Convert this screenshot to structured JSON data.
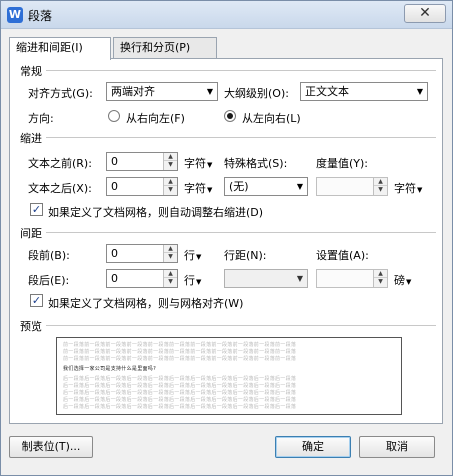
{
  "window": {
    "title": "段落",
    "close_glyph": "✕"
  },
  "tabs": [
    {
      "label": "缩进和间距(I)",
      "active": true
    },
    {
      "label": "换行和分页(P)",
      "active": false
    }
  ],
  "general": {
    "title": "常规",
    "align_label": "对齐方式(G):",
    "align_value": "两端对齐",
    "outline_label": "大纲级别(O):",
    "outline_value": "正文文本",
    "direction_label": "方向:",
    "rtl_label": "从右向左(F)",
    "ltr_label": "从左向右(L)",
    "direction_selected": "ltr"
  },
  "indent": {
    "title": "缩进",
    "before_label": "文本之前(R):",
    "before_value": "0",
    "before_unit": "字符",
    "after_label": "文本之后(X):",
    "after_value": "0",
    "after_unit": "字符",
    "special_label": "特殊格式(S):",
    "special_value": "(无)",
    "measure_label": "度量值(Y):",
    "measure_value": "",
    "measure_unit": "字符",
    "grid_check_label": "如果定义了文档网格，则自动调整右缩进(D)",
    "grid_checked": true
  },
  "spacing": {
    "title": "间距",
    "before_label": "段前(B):",
    "before_value": "0",
    "before_unit": "行",
    "after_label": "段后(E):",
    "after_value": "0",
    "after_unit": "行",
    "line_label": "行距(N):",
    "line_value": "",
    "set_label": "设置值(A):",
    "set_value": "",
    "set_unit": "磅",
    "grid_check_label": "如果定义了文档网格，则与网格对齐(W)",
    "grid_checked": true
  },
  "preview": {
    "title": "预览",
    "filler_text": "前一段落前一段落前一段落前一段落前一段落前一段落前一段落前一段落前一段落前一段落前一段落",
    "main_text": "我们选择一家公司是支持什么是里面吗?",
    "follow_text": "后一段落后一段落后一段落后一段落后一段落后一段落后一段落后一段落后一段落后一段落后一段落"
  },
  "buttons": {
    "tabs_label": "制表位(T)...",
    "ok_label": "确定",
    "cancel_label": "取消"
  },
  "icons": {
    "check": "✓",
    "dropdown": "▼",
    "spin_up": "▲",
    "spin_down": "▼"
  }
}
